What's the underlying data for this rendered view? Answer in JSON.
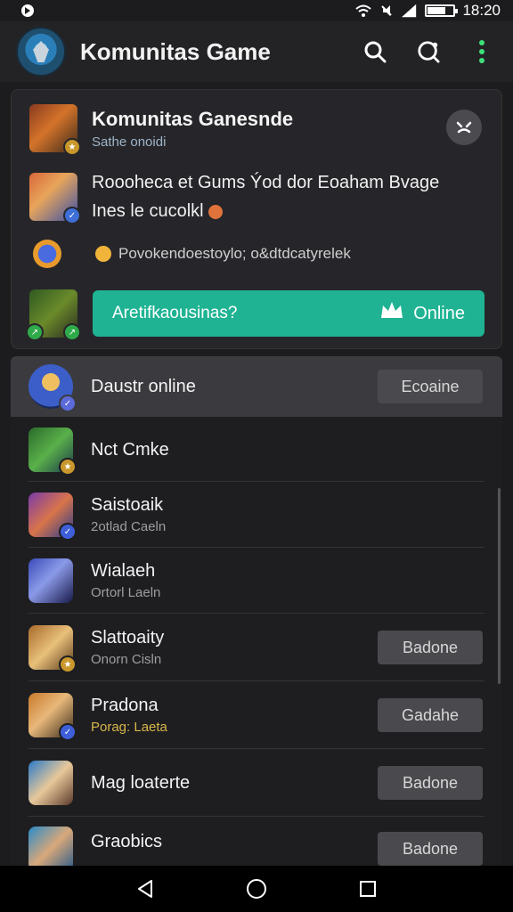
{
  "status_bar": {
    "time": "18:20",
    "battery_level": 0.7,
    "icons": [
      "notification-icon",
      "wifi-icon",
      "mute-icon",
      "signal-icon",
      "battery-icon"
    ]
  },
  "app_bar": {
    "title": "Komunitas Game",
    "actions": [
      "search-icon",
      "chat-search-icon",
      "more-vert-icon"
    ]
  },
  "card": {
    "title": "Komunitas Ganesnde",
    "subtitle": "Sathe onoidi",
    "message_line1": "Roooheca et Gums  Ýod dor Eoaham Bvage",
    "message_line2": "Ines le cucolkl",
    "emoji_row_text": "Povokendoestoylo; o&dtdcatyrelek",
    "action_label": "Aretifkaousinas?",
    "action_status": "Online"
  },
  "list": {
    "rows": [
      {
        "name": "Daustr online",
        "sub": "",
        "button": "Ecoaine",
        "highlight": true
      },
      {
        "name": "Nct Cmke",
        "sub": "",
        "button": ""
      },
      {
        "name": "Saistoaik",
        "sub": "2otlad Caeln",
        "button": ""
      },
      {
        "name": "Wialaeh",
        "sub": "Ortorl Laeln",
        "button": ""
      },
      {
        "name": "Slattoaity",
        "sub": "Onorn Cisln",
        "button": "Badone"
      },
      {
        "name": "Pradona",
        "sub": "Porag: Laeta",
        "button": "Gadahe"
      },
      {
        "name": "Mag loaterte",
        "sub": "",
        "button": "Badone"
      },
      {
        "name": "Graobics",
        "sub": "",
        "button": "Badone"
      }
    ]
  },
  "colors": {
    "accent": "#1fb393",
    "background": "#1c1c1e",
    "card": "#26262a"
  }
}
